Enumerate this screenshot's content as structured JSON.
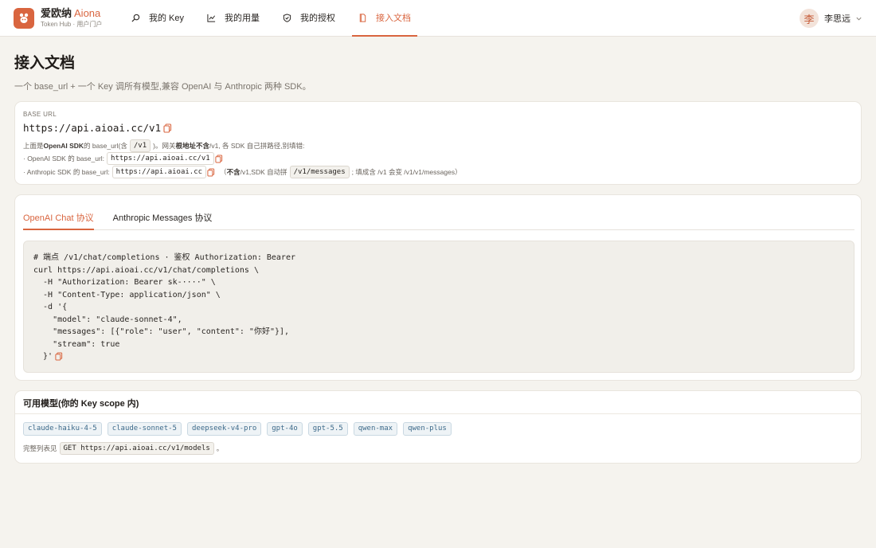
{
  "brand": {
    "name": "爱欧纳",
    "name_en": "Aiona",
    "subtitle": "Token Hub · 用户门户"
  },
  "nav": {
    "items": [
      {
        "label": "我的 Key",
        "icon": "search-icon"
      },
      {
        "label": "我的用量",
        "icon": "chart-icon"
      },
      {
        "label": "我的授权",
        "icon": "shield-icon"
      },
      {
        "label": "接入文档",
        "icon": "document-icon",
        "active": true
      }
    ]
  },
  "user": {
    "avatar": "李",
    "name": "李思远"
  },
  "page": {
    "title": "接入文档",
    "subtitle": "一个 base_url + 一个 Key 调所有模型,兼容 OpenAI 与 Anthropic 两种 SDK。"
  },
  "base": {
    "label": "BASE URL",
    "url": "https://api.aioai.cc/v1",
    "note1_a": "上面是 ",
    "note1_b": "OpenAI SDK",
    "note1_c": " 的 base_url(含 ",
    "note1_chip": "/v1",
    "note1_d": ")。网关",
    "note1_e": "根地址不含",
    "note1_f": " /v1, 各 SDK 自己拼路径,别填错:",
    "note2_a": "· OpenAI SDK 的 base_url: ",
    "note2_chip": "https://api.aioai.cc/v1",
    "note3_a": "· Anthropic SDK 的 base_url: ",
    "note3_chip": "https://api.aioai.cc",
    "note3_b": "（",
    "note3_c": "不含",
    "note3_d": " /v1,SDK 自动拼 ",
    "note3_chip2": "/v1/messages",
    "note3_e": "; 填成含 /v1 会变 /v1/v1/messages）"
  },
  "tabs": [
    {
      "label": "OpenAI Chat 协议",
      "active": true
    },
    {
      "label": "Anthropic Messages 协议",
      "active": false
    }
  ],
  "code": {
    "lines": [
      "# 端点 /v1/chat/completions · 鉴权 Authorization: Bearer",
      "curl https://api.aioai.cc/v1/chat/completions \\",
      "  -H \"Authorization: Bearer sk-····\" \\",
      "  -H \"Content-Type: application/json\" \\",
      "  -d '{",
      "    \"model\": \"claude-sonnet-4\",",
      "    \"messages\": [{\"role\": \"user\", \"content\": \"你好\"}],",
      "    \"stream\": true",
      "  }'"
    ]
  },
  "models": {
    "title": "可用模型(你的 Key scope 内)",
    "list": [
      "claude-haiku-4-5",
      "claude-sonnet-5",
      "deepseek-v4-pro",
      "gpt-4o",
      "gpt-5.5",
      "qwen-max",
      "qwen-plus"
    ],
    "foot_a": "完整列表见 ",
    "foot_chip": "GET https://api.aioai.cc/v1/models",
    "foot_b": " 。"
  },
  "colors": {
    "accent": "#d9653f",
    "background": "#f5f3ee",
    "model_chip": "#3d6a8a"
  }
}
